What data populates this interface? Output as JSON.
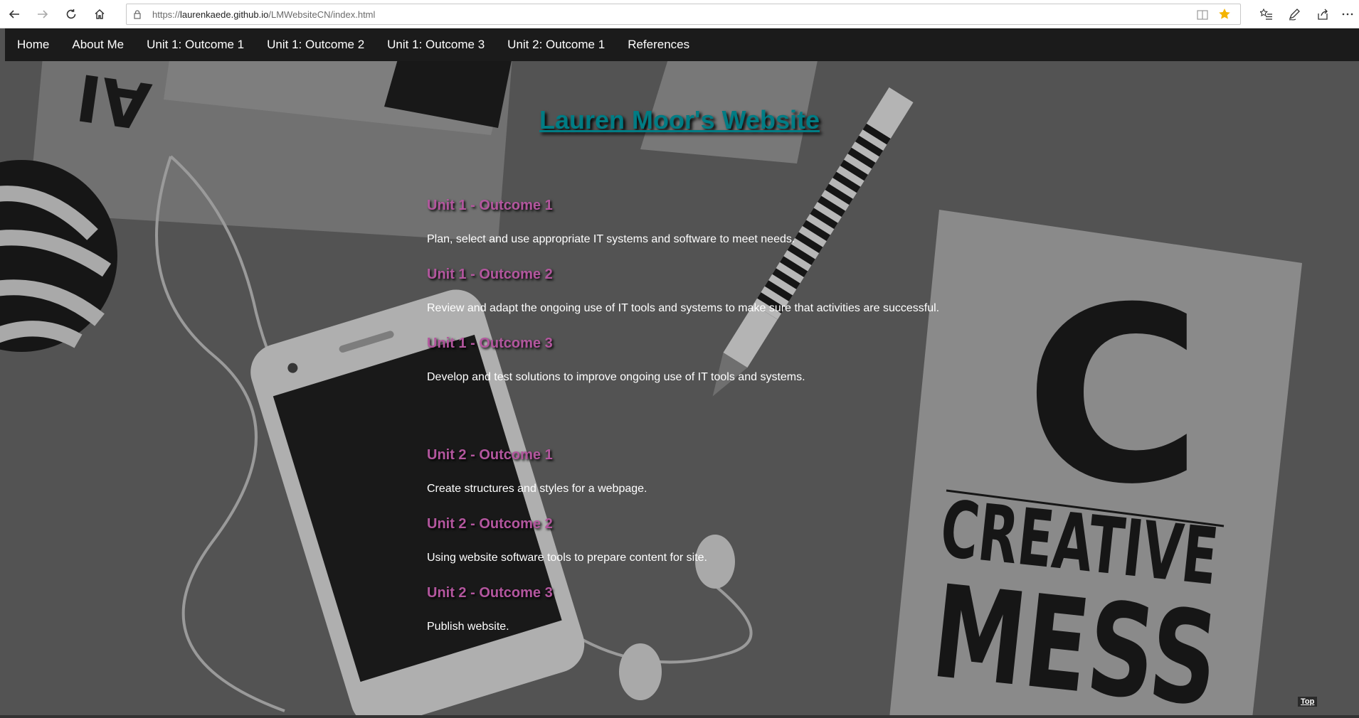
{
  "browser": {
    "url_scheme": "https://",
    "url_host": "laurenkaede.github.io",
    "url_path": "/LMWebsiteCN/index.html"
  },
  "site": {
    "nav": [
      {
        "label": "Home"
      },
      {
        "label": "About Me"
      },
      {
        "label": "Unit 1: Outcome 1"
      },
      {
        "label": "Unit 1: Outcome 2"
      },
      {
        "label": "Unit 1: Outcome 3"
      },
      {
        "label": "Unit 2: Outcome 1"
      },
      {
        "label": "References"
      }
    ],
    "title": "Lauren Moor's Website",
    "unit1": [
      {
        "heading": "Unit 1 - Outcome 1",
        "text": "Plan, select and use appropriate IT systems and software to meet needs."
      },
      {
        "heading": "Unit 1 - Outcome 2",
        "text": "Review and adapt the ongoing use of IT tools and systems to make sure that activities are successful."
      },
      {
        "heading": "Unit 1 - Outcome 3",
        "text": "Develop and test solutions to improve ongoing use of IT tools and systems."
      }
    ],
    "unit2": [
      {
        "heading": "Unit 2 - Outcome 1",
        "text": "Create structures and styles for a webpage."
      },
      {
        "heading": "Unit 2 - Outcome 2",
        "text": "Using website software tools to prepare content for site."
      },
      {
        "heading": "Unit 2 - Outcome 3",
        "text": "Publish website."
      }
    ],
    "top_link": "Top",
    "background_text": {
      "big_letter": "C",
      "line1": "CREATIVE",
      "line2": "MESS"
    }
  },
  "colors": {
    "title": "#007c84",
    "heading": "#b3569e",
    "nav_bg": "#1b1b1b"
  }
}
